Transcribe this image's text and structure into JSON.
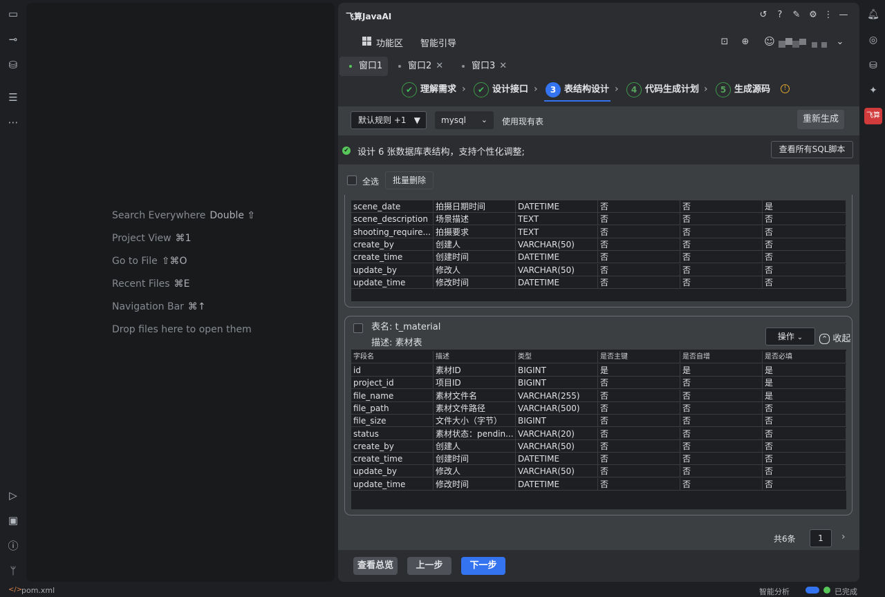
{
  "editor": {
    "hints": [
      {
        "label": "Search Everywhere",
        "key": "Double ⇧"
      },
      {
        "label": "Project View",
        "key": "⌘1"
      },
      {
        "label": "Go to File",
        "key": "⇧⌘O"
      },
      {
        "label": "Recent Files",
        "key": "⌘E"
      },
      {
        "label": "Navigation Bar",
        "key": "⌘↑"
      },
      {
        "label": "Drop files here to open them",
        "key": ""
      }
    ]
  },
  "panel": {
    "title": "飞算JavaAI",
    "nav": {
      "functions": "功能区",
      "guide": "智能引导"
    },
    "window_tabs": [
      "窗口1",
      "窗口2",
      "窗口3"
    ],
    "steps": [
      {
        "num": "✔",
        "label": "理解需求"
      },
      {
        "num": "✔",
        "label": "设计接口"
      },
      {
        "num": "3",
        "label": "表结构设计"
      },
      {
        "num": "4",
        "label": "代码生成计划"
      },
      {
        "num": "5",
        "label": "生成源码"
      }
    ],
    "toolbar": {
      "rule_select": "默认规则 +1",
      "db_select": "mysql",
      "use_existing": "使用现有表",
      "regenerate": "重新生成"
    },
    "summary": {
      "text": "设计 6 张数据库表结构，支持个性化调整;",
      "view_sql": "查看所有SQL脚本"
    },
    "bulk": {
      "select_all": "全选",
      "batch_delete": "批量删除"
    },
    "columns": [
      "字段名",
      "描述",
      "类型",
      "是否主键",
      "是否自增",
      "是否必填"
    ],
    "table_prev_rows": [
      [
        "scene_date",
        "拍摄日期时间",
        "DATETIME",
        "否",
        "否",
        "是"
      ],
      [
        "scene_description",
        "场景描述",
        "TEXT",
        "否",
        "否",
        "否"
      ],
      [
        "shooting_require...",
        "拍摄要求",
        "TEXT",
        "否",
        "否",
        "否"
      ],
      [
        "create_by",
        "创建人",
        "VARCHAR(50)",
        "否",
        "否",
        "否"
      ],
      [
        "create_time",
        "创建时间",
        "DATETIME",
        "否",
        "否",
        "否"
      ],
      [
        "update_by",
        "修改人",
        "VARCHAR(50)",
        "否",
        "否",
        "否"
      ],
      [
        "update_time",
        "修改时间",
        "DATETIME",
        "否",
        "否",
        "否"
      ]
    ],
    "material": {
      "name_label": "表名: t_material",
      "desc_label": "描述: 素材表",
      "ops": "操作",
      "collapse": "收起",
      "rows": [
        [
          "id",
          "素材ID",
          "BIGINT",
          "是",
          "是",
          "是"
        ],
        [
          "project_id",
          "项目ID",
          "BIGINT",
          "否",
          "否",
          "是"
        ],
        [
          "file_name",
          "素材文件名",
          "VARCHAR(255)",
          "否",
          "否",
          "是"
        ],
        [
          "file_path",
          "素材文件路径",
          "VARCHAR(500)",
          "否",
          "否",
          "否"
        ],
        [
          "file_size",
          "文件大小（字节）",
          "BIGINT",
          "否",
          "否",
          "否"
        ],
        [
          "status",
          "素材状态：pendin...",
          "VARCHAR(20)",
          "否",
          "否",
          "否"
        ],
        [
          "create_by",
          "创建人",
          "VARCHAR(50)",
          "否",
          "否",
          "否"
        ],
        [
          "create_time",
          "创建时间",
          "DATETIME",
          "否",
          "否",
          "否"
        ],
        [
          "update_by",
          "修改人",
          "VARCHAR(50)",
          "否",
          "否",
          "否"
        ],
        [
          "update_time",
          "修改时间",
          "DATETIME",
          "否",
          "否",
          "否"
        ]
      ]
    },
    "pager": {
      "total": "共6条",
      "page": "1"
    },
    "footer": {
      "overview": "查看总览",
      "prev": "上一步",
      "next": "下一步"
    }
  },
  "rightbar": {
    "brand": "飞算"
  },
  "statusbar": {
    "file": "pom.xml",
    "analysis": "智能分析",
    "done": "已完成"
  },
  "colors": {
    "accent": "#3574f0",
    "success": "#57c75a",
    "brand_red": "#d23b3b"
  }
}
